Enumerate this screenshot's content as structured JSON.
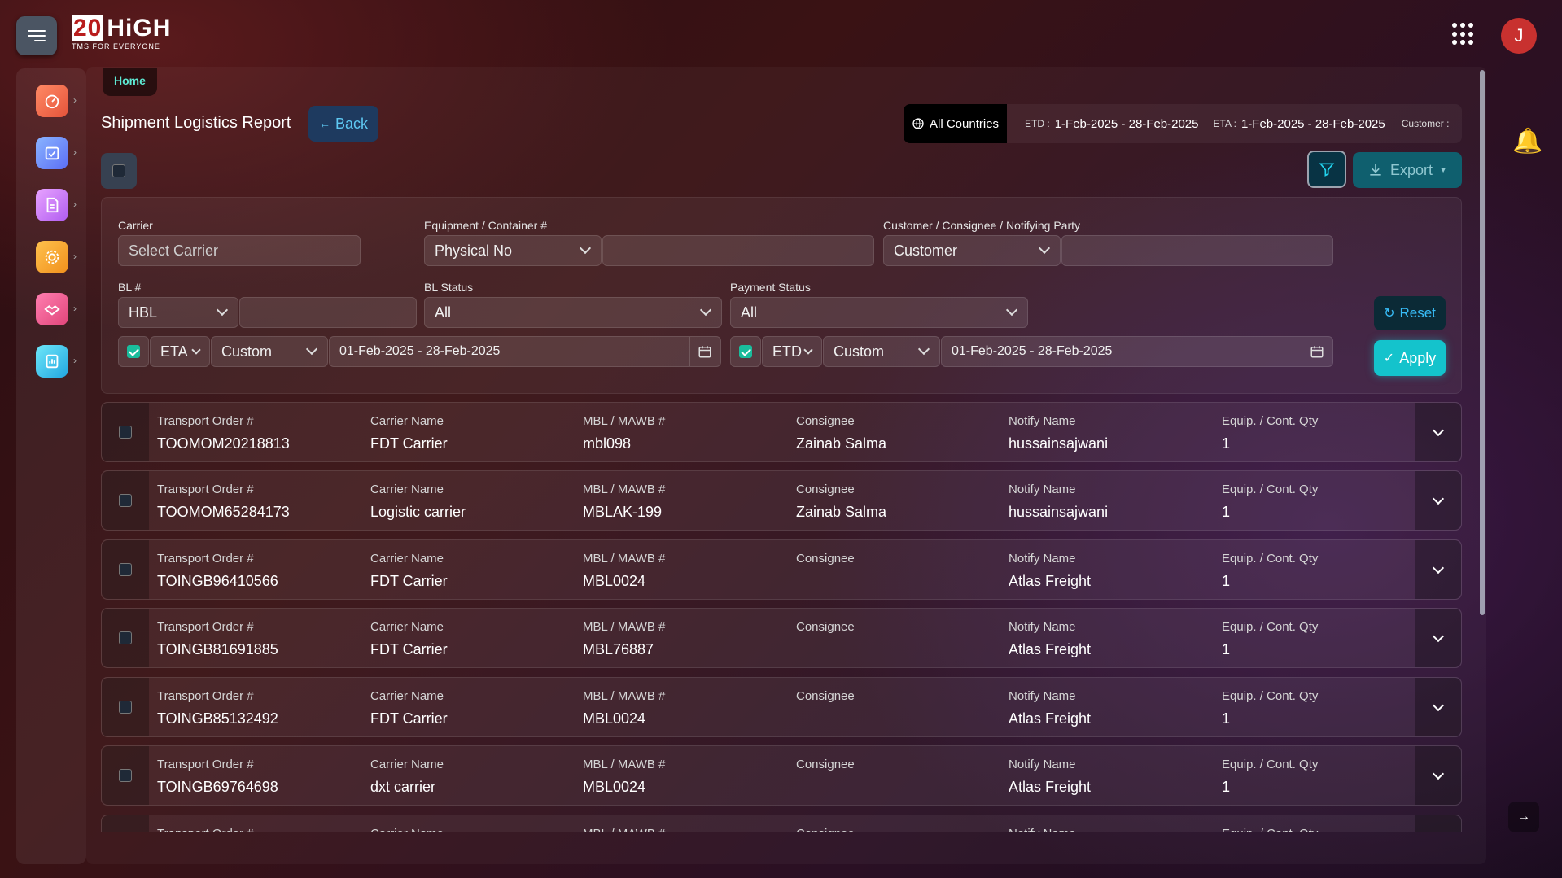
{
  "brand": {
    "logo_num": "20",
    "logo_text": "HiGH",
    "tagline": "TMS FOR EVERYONE"
  },
  "user": {
    "avatar_initial": "J"
  },
  "breadcrumb": "Home",
  "page": {
    "title": "Shipment Logistics Report",
    "back_label": "Back"
  },
  "summary": {
    "country": "All Countries",
    "etd_label": "ETD :",
    "etd_value": "1-Feb-2025 - 28-Feb-2025",
    "eta_label": "ETA :",
    "eta_value": "1-Feb-2025 - 28-Feb-2025",
    "customer_label": "Customer :"
  },
  "toolbar": {
    "export_label": "Export"
  },
  "filters": {
    "carrier_label": "Carrier",
    "carrier_placeholder": "Select Carrier",
    "equipment_label": "Equipment / Container #",
    "equipment_type": "Physical No",
    "party_label": "Customer / Consignee / Notifying Party",
    "party_type": "Customer",
    "bl_label": "BL #",
    "bl_type": "HBL",
    "bl_status_label": "BL Status",
    "bl_status_value": "All",
    "payment_status_label": "Payment Status",
    "payment_status_value": "All",
    "eta_field": "ETA",
    "eta_mode": "Custom",
    "eta_range": "01-Feb-2025 - 28-Feb-2025",
    "etd_field": "ETD",
    "etd_mode": "Custom",
    "etd_range": "01-Feb-2025 - 28-Feb-2025",
    "reset_label": "Reset",
    "apply_label": "Apply"
  },
  "columns": {
    "transport_order": "Transport Order #",
    "carrier_name": "Carrier Name",
    "mbl": "MBL / MAWB #",
    "consignee": "Consignee",
    "notify": "Notify Name",
    "qty": "Equip. / Cont. Qty"
  },
  "rows": [
    {
      "order": "TOOMOM20218813",
      "carrier": "FDT Carrier",
      "mbl": "mbl098",
      "consignee": "Zainab Salma",
      "notify": "hussainsajwani",
      "qty": "1"
    },
    {
      "order": "TOOMOM65284173",
      "carrier": "Logistic carrier",
      "mbl": "MBLAK-199",
      "consignee": "Zainab Salma",
      "notify": "hussainsajwani",
      "qty": "1"
    },
    {
      "order": "TOINGB96410566",
      "carrier": "FDT Carrier",
      "mbl": "MBL0024",
      "consignee": "",
      "notify": "Atlas Freight",
      "qty": "1"
    },
    {
      "order": "TOINGB81691885",
      "carrier": "FDT Carrier",
      "mbl": "MBL76887",
      "consignee": "",
      "notify": "Atlas Freight",
      "qty": "1"
    },
    {
      "order": "TOINGB85132492",
      "carrier": "FDT Carrier",
      "mbl": "MBL0024",
      "consignee": "",
      "notify": "Atlas Freight",
      "qty": "1"
    },
    {
      "order": "TOINGB69764698",
      "carrier": "dxt carrier",
      "mbl": "MBL0024",
      "consignee": "",
      "notify": "Atlas Freight",
      "qty": "1"
    },
    {
      "order": "",
      "carrier": "",
      "mbl": "",
      "consignee": "",
      "notify": "",
      "qty": ""
    }
  ],
  "sidebar_icons": [
    "dashboard-icon",
    "calendar-check-icon",
    "document-icon",
    "settings-gear-icon",
    "handshake-icon",
    "report-icon"
  ],
  "colors": {
    "accent": "#14c3cc",
    "breadcrumb": "#5eead4",
    "avatar": "#c8312f",
    "bell": "#f5c518"
  }
}
